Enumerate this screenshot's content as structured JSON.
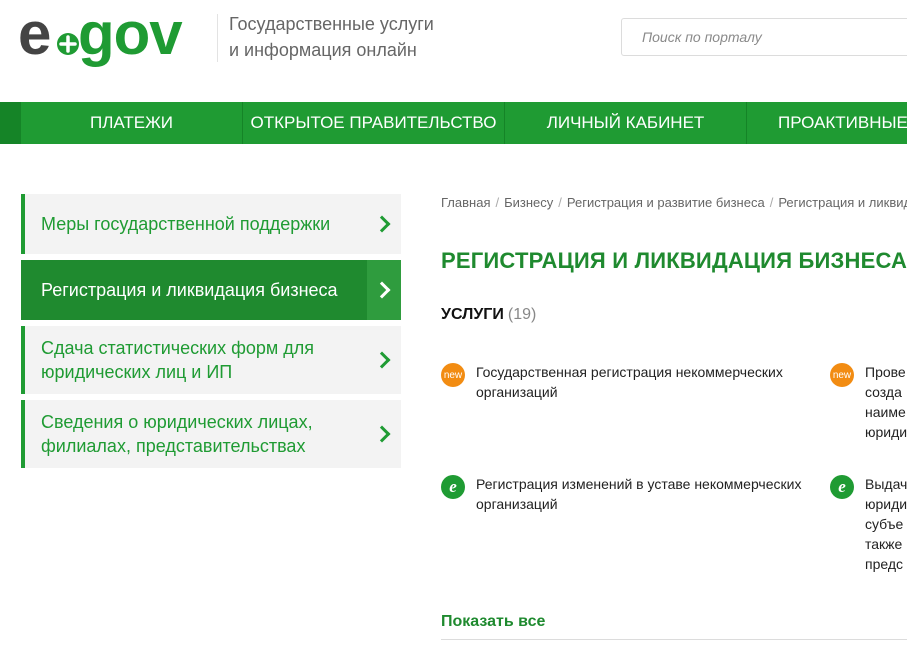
{
  "header": {
    "logo": {
      "text_e": "e",
      "text_gov": "gov"
    },
    "tagline_line1": "Государственные услуги",
    "tagline_line2": "и информация онлайн",
    "search_placeholder": "Поиск по порталу"
  },
  "nav": {
    "items": [
      {
        "label": "ПЛАТЕЖИ"
      },
      {
        "label": "ОТКРЫТОЕ ПРАВИТЕЛЬСТВО"
      },
      {
        "label": "ЛИЧНЫЙ КАБИНЕТ"
      },
      {
        "label": "ПРОАКТИВНЫЕ У"
      }
    ]
  },
  "sidebar": {
    "items": [
      {
        "label": "Меры государственной поддержки",
        "active": false
      },
      {
        "label": "Регистрация и ликвидация бизнеса",
        "active": true
      },
      {
        "label": "Сдача статистических форм для юридических лиц и ИП",
        "active": false
      },
      {
        "label": "Сведения о юридических лицах, филиалах, представительствах",
        "active": false
      }
    ]
  },
  "breadcrumb": [
    "Главная",
    "Бизнесу",
    "Регистрация и развитие бизнеса",
    "Регистрация и ликвида"
  ],
  "page_title": "РЕГИСТРАЦИЯ И ЛИКВИДАЦИЯ БИЗНЕСА",
  "services_section": {
    "title": "УСЛУГИ",
    "count": "(19)",
    "items": [
      {
        "badge": "new",
        "badge_text": "new",
        "text": "Государственная регистрация некоммерческих организаций"
      },
      {
        "badge": "new",
        "badge_text": "new",
        "text": "Прове созда наиме юриди"
      },
      {
        "badge": "e",
        "badge_text": "e",
        "text": "Регистрация изменений в уставе некоммерческих организаций"
      },
      {
        "badge": "e",
        "badge_text": "e",
        "text": "Выдач юриди субъе также предс"
      }
    ]
  },
  "show_all": "Показать все",
  "colors": {
    "brand_green": "#1f9b33",
    "dark_green": "#1f8a2f",
    "new_badge": "#f28c12",
    "logo_gray": "#444444"
  }
}
